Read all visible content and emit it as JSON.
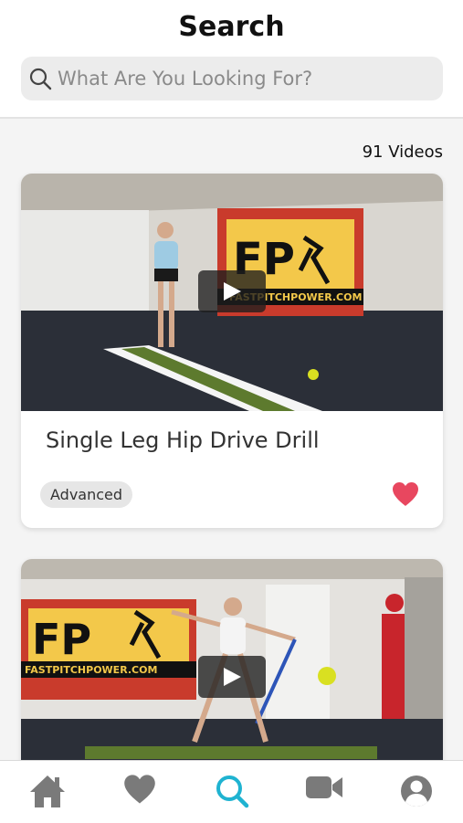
{
  "header": {
    "title": "Search",
    "search_placeholder": "What Are You Looking For?"
  },
  "results": {
    "count_label": "91 Videos",
    "videos": [
      {
        "title": "Single Leg Hip Drive Drill",
        "level": "Advanced",
        "favorited": true,
        "banner_text": "FASTPITCHPOWER.COM"
      },
      {
        "title": "",
        "banner_text": "FASTPITCHPOWER.COM"
      }
    ]
  },
  "tabbar": {
    "tabs": [
      {
        "icon": "home-icon",
        "active": false
      },
      {
        "icon": "heart-icon",
        "active": false
      },
      {
        "icon": "search-icon",
        "active": true
      },
      {
        "icon": "video-camera-icon",
        "active": false
      },
      {
        "icon": "user-icon",
        "active": false
      }
    ]
  },
  "colors": {
    "accent": "#1fb3d1",
    "tab_inactive": "#7a7a7a",
    "heart": "#e8475f",
    "badge_bg": "#e6e6e6"
  }
}
